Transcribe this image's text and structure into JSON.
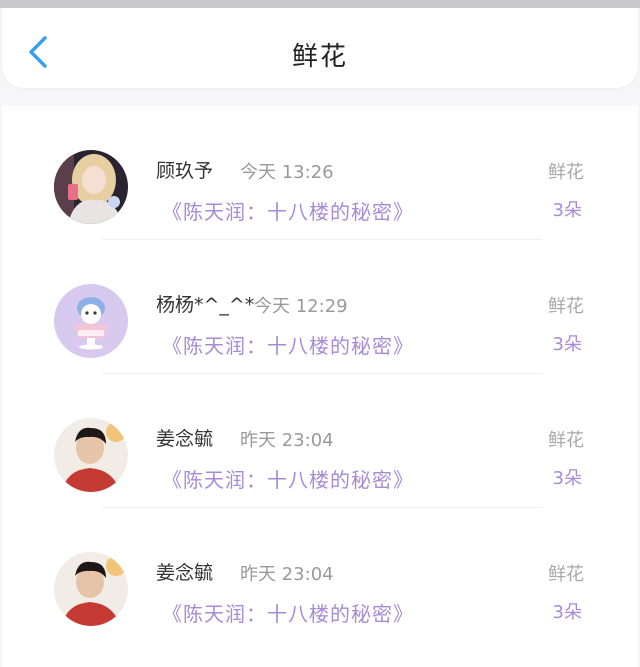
{
  "header": {
    "title": "鲜花",
    "back_icon": "chevron-left-icon",
    "accent_color": "#3a9ef2"
  },
  "records": [
    {
      "name": "顾玖予",
      "time": "今天 13:26",
      "gift": "鲜花",
      "book": "《陈天润：十八楼的秘密》",
      "count": "3朵",
      "avatar_icon": "avatar-photo-blonde-girl"
    },
    {
      "name": "杨杨*^_^*",
      "time": "今天 12:29",
      "gift": "鲜花",
      "book": "《陈天润：十八楼的秘密》",
      "count": "3朵",
      "avatar_icon": "avatar-cartoon-cat-dessert"
    },
    {
      "name": "姜念毓",
      "time": "昨天 23:04",
      "gift": "鲜花",
      "book": "《陈天润：十八楼的秘密》",
      "count": "3朵",
      "avatar_icon": "avatar-photo-boy-red-shirt"
    },
    {
      "name": "姜念毓",
      "time": "昨天 23:04",
      "gift": "鲜花",
      "book": "《陈天润：十八楼的秘密》",
      "count": "3朵",
      "avatar_icon": "avatar-photo-boy-red-shirt"
    }
  ],
  "colors": {
    "book_link": "#a78bd6",
    "gift_label": "#a8a8a8",
    "time": "#9a9a9a"
  }
}
